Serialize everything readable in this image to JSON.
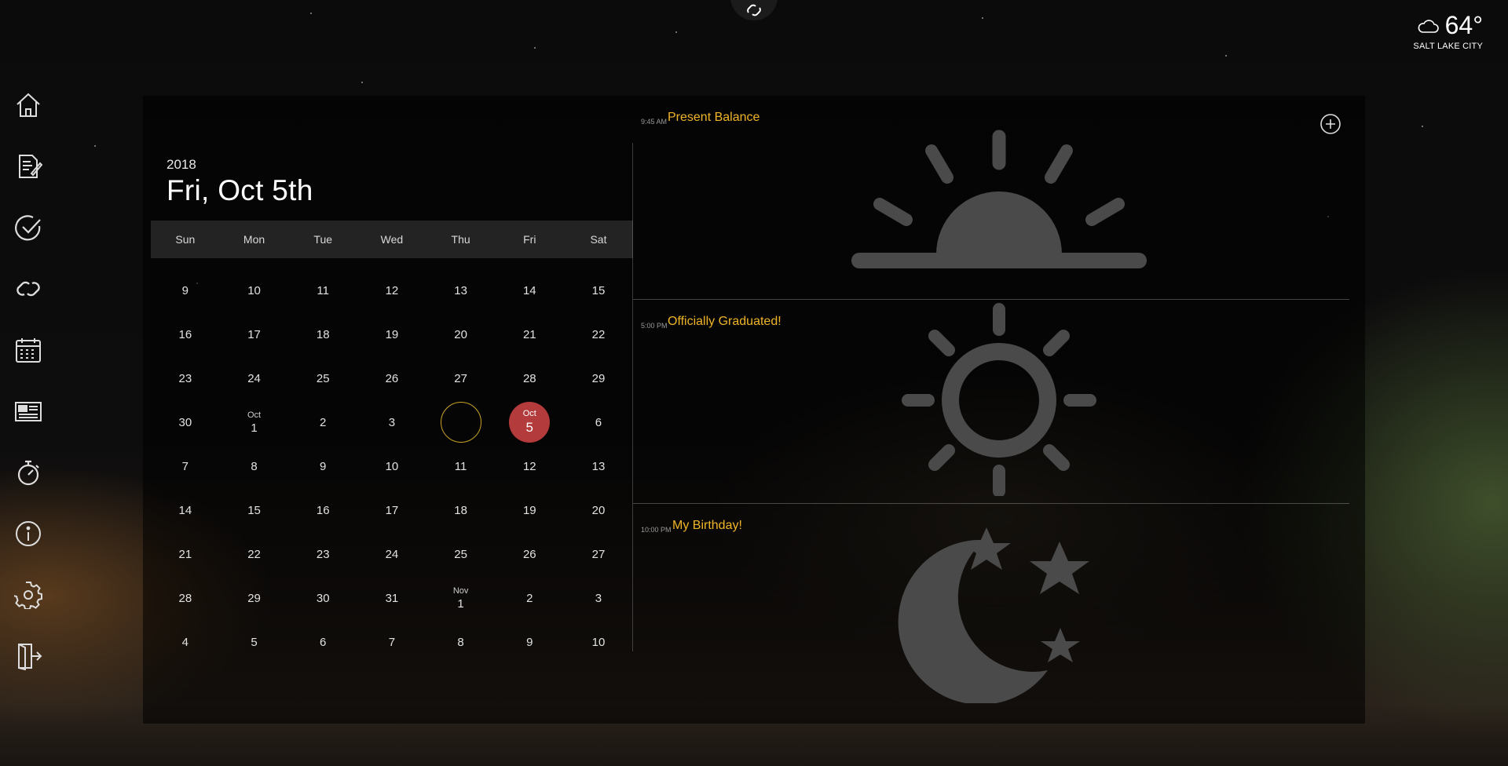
{
  "weather": {
    "temperature": "64°",
    "city": "SALT LAKE CITY",
    "icon": "cloud-icon"
  },
  "sidebar": {
    "items": [
      {
        "id": "home",
        "icon": "home-icon"
      },
      {
        "id": "notes",
        "icon": "notes-icon"
      },
      {
        "id": "tasks",
        "icon": "checkmark-icon"
      },
      {
        "id": "links",
        "icon": "link-icon"
      },
      {
        "id": "calendar",
        "icon": "calendar-icon"
      },
      {
        "id": "news",
        "icon": "newspaper-icon"
      },
      {
        "id": "timer",
        "icon": "stopwatch-icon"
      },
      {
        "id": "info",
        "icon": "info-icon"
      },
      {
        "id": "settings",
        "icon": "gear-icon"
      },
      {
        "id": "logout",
        "icon": "logout-icon"
      }
    ]
  },
  "calendar": {
    "year": "2018",
    "date_label": "Fri, Oct 5th",
    "weekdays": [
      "Sun",
      "Mon",
      "Tue",
      "Wed",
      "Thu",
      "Fri",
      "Sat"
    ],
    "weeks": [
      [
        {
          "d": "9"
        },
        {
          "d": "10"
        },
        {
          "d": "11"
        },
        {
          "d": "12"
        },
        {
          "d": "13"
        },
        {
          "d": "14"
        },
        {
          "d": "15"
        }
      ],
      [
        {
          "d": "16"
        },
        {
          "d": "17"
        },
        {
          "d": "18"
        },
        {
          "d": "19"
        },
        {
          "d": "20"
        },
        {
          "d": "21"
        },
        {
          "d": "22"
        }
      ],
      [
        {
          "d": "23"
        },
        {
          "d": "24"
        },
        {
          "d": "25"
        },
        {
          "d": "26"
        },
        {
          "d": "27"
        },
        {
          "d": "28"
        },
        {
          "d": "29"
        }
      ],
      [
        {
          "d": "30"
        },
        {
          "d": "1",
          "m": "Oct"
        },
        {
          "d": "2"
        },
        {
          "d": "3"
        },
        {
          "d": "",
          "state": "outline"
        },
        {
          "d": "5",
          "m": "Oct",
          "state": "selected"
        },
        {
          "d": "6"
        }
      ],
      [
        {
          "d": "7"
        },
        {
          "d": "8"
        },
        {
          "d": "9"
        },
        {
          "d": "10"
        },
        {
          "d": "11"
        },
        {
          "d": "12"
        },
        {
          "d": "13"
        }
      ],
      [
        {
          "d": "14"
        },
        {
          "d": "15"
        },
        {
          "d": "16"
        },
        {
          "d": "17"
        },
        {
          "d": "18"
        },
        {
          "d": "19"
        },
        {
          "d": "20"
        }
      ],
      [
        {
          "d": "21"
        },
        {
          "d": "22"
        },
        {
          "d": "23"
        },
        {
          "d": "24"
        },
        {
          "d": "25"
        },
        {
          "d": "26"
        },
        {
          "d": "27"
        }
      ],
      [
        {
          "d": "28"
        },
        {
          "d": "29"
        },
        {
          "d": "30"
        },
        {
          "d": "31"
        },
        {
          "d": "1",
          "m": "Nov"
        },
        {
          "d": "2"
        },
        {
          "d": "3"
        }
      ],
      [
        {
          "d": "4"
        },
        {
          "d": "5"
        },
        {
          "d": "6"
        },
        {
          "d": "7"
        },
        {
          "d": "8"
        },
        {
          "d": "9"
        },
        {
          "d": "10"
        }
      ]
    ]
  },
  "events": [
    {
      "time": "9:45 AM",
      "title": "Present Balance",
      "art": "sunrise-icon"
    },
    {
      "time": "5:00 PM",
      "title": "Officially Graduated!",
      "art": "sun-icon"
    },
    {
      "time": "10:00 PM",
      "title": "My Birthday!",
      "art": "moon-stars-icon"
    }
  ],
  "colors": {
    "accent_title": "#f0b429",
    "selected_day": "#b33b3b",
    "today_ring": "#c9a227"
  }
}
